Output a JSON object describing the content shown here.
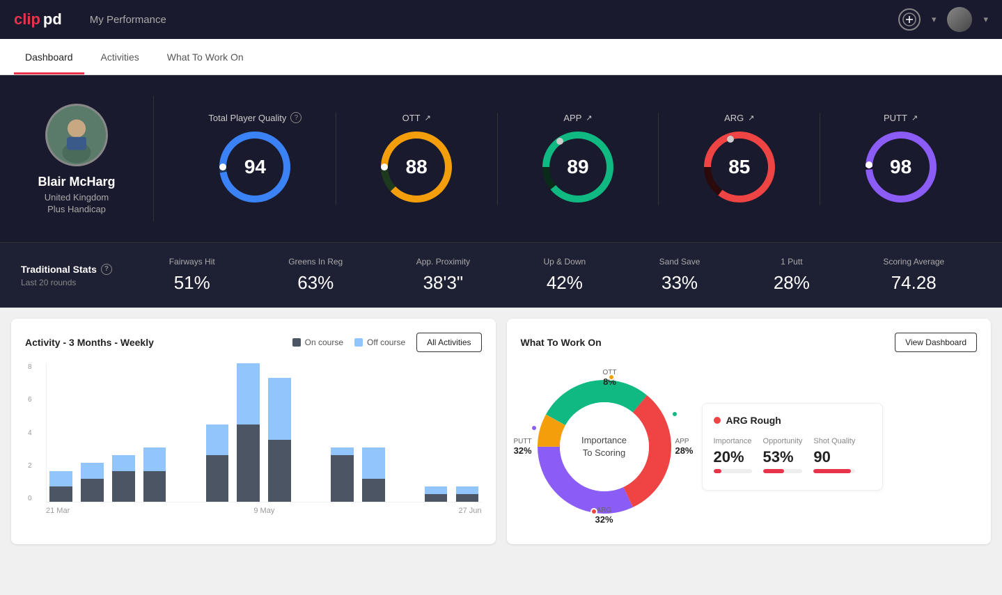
{
  "app": {
    "logo": "clippd",
    "title": "My Performance"
  },
  "nav": {
    "tabs": [
      {
        "id": "dashboard",
        "label": "Dashboard",
        "active": true
      },
      {
        "id": "activities",
        "label": "Activities",
        "active": false
      },
      {
        "id": "what-to-work-on",
        "label": "What To Work On",
        "active": false
      }
    ]
  },
  "hero": {
    "avatar_emoji": "🏌️",
    "name": "Blair McHarg",
    "country": "United Kingdom",
    "handicap": "Plus Handicap",
    "total_quality_label": "Total Player Quality",
    "scores": [
      {
        "id": "total",
        "value": 94,
        "color": "#3b82f6",
        "bg_color": "#1e3a5f",
        "label": "",
        "trend": ""
      },
      {
        "id": "ott",
        "value": 88,
        "color": "#f59e0b",
        "label": "OTT",
        "trend": "↗"
      },
      {
        "id": "app",
        "value": 89,
        "color": "#10b981",
        "label": "APP",
        "trend": "↗"
      },
      {
        "id": "arg",
        "value": 85,
        "color": "#ef4444",
        "label": "ARG",
        "trend": "↗"
      },
      {
        "id": "putt",
        "value": 98,
        "color": "#8b5cf6",
        "label": "PUTT",
        "trend": "↗"
      }
    ]
  },
  "stats": {
    "label": "Traditional Stats",
    "sublabel": "Last 20 rounds",
    "items": [
      {
        "label": "Fairways Hit",
        "value": "51%"
      },
      {
        "label": "Greens In Reg",
        "value": "63%"
      },
      {
        "label": "App. Proximity",
        "value": "38'3\""
      },
      {
        "label": "Up & Down",
        "value": "42%"
      },
      {
        "label": "Sand Save",
        "value": "33%"
      },
      {
        "label": "1 Putt",
        "value": "28%"
      },
      {
        "label": "Scoring Average",
        "value": "74.28"
      }
    ]
  },
  "activity_chart": {
    "title": "Activity - 3 Months - Weekly",
    "legend": [
      {
        "label": "On course",
        "color": "#4b5563"
      },
      {
        "label": "Off course",
        "color": "#93c5fd"
      }
    ],
    "all_activities_btn": "All Activities",
    "y_labels": [
      "8",
      "6",
      "4",
      "2",
      "0"
    ],
    "x_labels": [
      "21 Mar",
      "9 May",
      "27 Jun"
    ],
    "bars": [
      {
        "on": 1,
        "off": 1
      },
      {
        "on": 1.5,
        "off": 1
      },
      {
        "on": 2,
        "off": 1
      },
      {
        "on": 2,
        "off": 1.5
      },
      {
        "on": 0,
        "off": 0
      },
      {
        "on": 3,
        "off": 2
      },
      {
        "on": 5,
        "off": 4
      },
      {
        "on": 4,
        "off": 4
      },
      {
        "on": 0,
        "off": 0
      },
      {
        "on": 3,
        "off": 0.5
      },
      {
        "on": 1.5,
        "off": 2
      },
      {
        "on": 0,
        "off": 0
      },
      {
        "on": 0.5,
        "off": 0.5
      },
      {
        "on": 0.5,
        "off": 0.5
      }
    ]
  },
  "what_to_work_on": {
    "title": "What To Work On",
    "view_dashboard_btn": "View Dashboard",
    "donut_center": "Importance\nTo Scoring",
    "segments": [
      {
        "label": "OTT",
        "pct": "8%",
        "color": "#f59e0b",
        "value": 8
      },
      {
        "label": "APP",
        "pct": "28%",
        "color": "#10b981",
        "value": 28
      },
      {
        "label": "ARG",
        "pct": "32%",
        "color": "#ef4444",
        "value": 32
      },
      {
        "label": "PUTT",
        "pct": "32%",
        "color": "#8b5cf6",
        "value": 32
      }
    ],
    "highlight_card": {
      "title": "ARG Rough",
      "dot_color": "#ef4444",
      "metrics": [
        {
          "label": "Importance",
          "value": "20%",
          "pct": 20
        },
        {
          "label": "Opportunity",
          "value": "53%",
          "pct": 53
        },
        {
          "label": "Shot Quality",
          "value": "90",
          "pct": 90
        }
      ]
    }
  }
}
